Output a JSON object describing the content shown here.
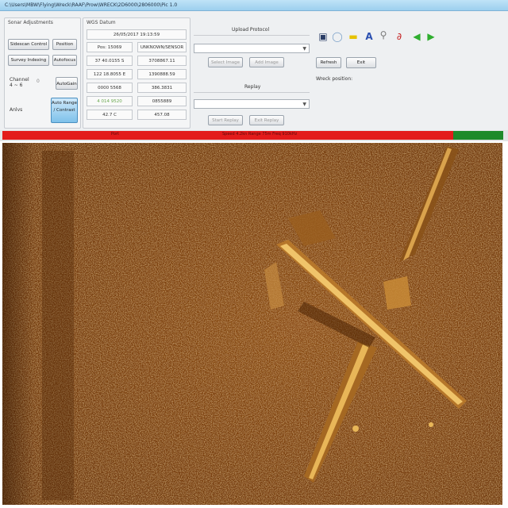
{
  "window": {
    "title": "C:\\Users\\MBW\\Flying\\Wreck\\RAAF\\Prow\\WRECK\\2D6000\\2806000\\Pic 1.0"
  },
  "sonar_setup": {
    "group_title": "Sonar Adjustments",
    "buttons": [
      "Sidescan Control",
      "Position",
      "Survey Indexing",
      "Autofocus"
    ],
    "channel_label": "Channel\n4 ~ 6",
    "channel_value": "0",
    "autogain_label": "AutoGain",
    "lower_left_label": "Anlvs",
    "auto_depth_button": "Auto Range / Contrast"
  },
  "wrecks_coords": {
    "group_title": "WGS Datum",
    "header": "26/05/2017 19:13:59",
    "left_values": [
      "Pos: 15069",
      "37 40.0155 S",
      "122 18.8055 E",
      "0000 5568",
      "4 014 9520",
      "42.7  C"
    ],
    "right_values": [
      "UNKNOWN/SENSOR",
      "3708867.11",
      "1390888.59",
      "386.3831",
      "0855889",
      "457.08"
    ]
  },
  "upload_section": {
    "title": "Upload Protocol",
    "buttons": [
      "Select Image",
      "Add Image"
    ]
  },
  "replay_section": {
    "title": "Replay",
    "buttons": [
      "Start Replay",
      "Exit Replay"
    ]
  },
  "toolbar_icons": [
    "save-icon",
    "globe-icon",
    "folder-icon",
    "font-icon",
    "zoom-icon",
    "clip-icon",
    "arrow-left-icon",
    "arrow-right-icon"
  ],
  "side_buttons": [
    "Refresh",
    "Exit"
  ],
  "info_label": "Wreck position:",
  "status_bar": {
    "left_text": "Port",
    "mid_text": "Speed 4.2kn   Range 75m   Freq 910kHz",
    "red_fraction": 0.9,
    "colors": {
      "red": "#e31b1b",
      "green": "#1d8a2a"
    }
  },
  "sonar_image": {
    "description_label": "sidescan-sonar-waterfall",
    "palette": {
      "background": "#7a3f0c",
      "highlight": "#e8b65a"
    }
  }
}
